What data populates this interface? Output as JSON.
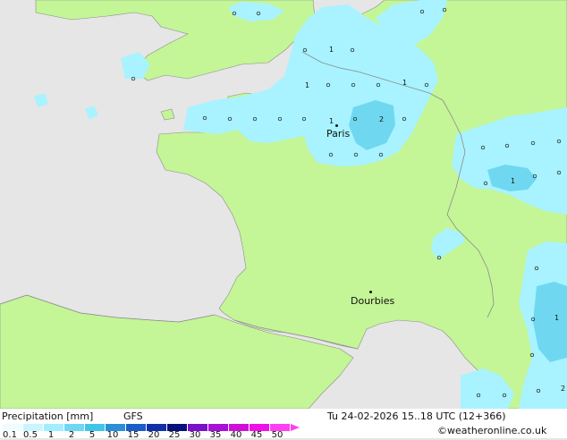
{
  "colors": {
    "sea": "#e6e6e6",
    "land": "#c4f597",
    "precip_light": "#a8f3ff",
    "precip_mid": "#6fd8f0",
    "precip_strong": "#3ec6e8",
    "border": "#8c8c8c"
  },
  "map": {
    "places": [
      {
        "name": "Paris"
      },
      {
        "name": "Dourbies"
      }
    ],
    "value_labels": [
      "1",
      "2",
      "1",
      "1",
      "1",
      "1",
      "1",
      "2"
    ]
  },
  "footer": {
    "title": "Precipitation [mm]",
    "model": "GFS",
    "timestamp": "Tu 24-02-2026 15..18 UTC (12+366)",
    "copyright": "©weatheronline.co.uk"
  },
  "legend": {
    "ticks": [
      "0.1",
      "0.5",
      "1",
      "2",
      "5",
      "10",
      "15",
      "20",
      "25",
      "30",
      "35",
      "40",
      "45",
      "50"
    ],
    "colors": [
      "#f0fcff",
      "#c8f5ff",
      "#a0eeff",
      "#6fd8f0",
      "#3ec6e8",
      "#2a8ed8",
      "#1c5cc8",
      "#1030a8",
      "#08107a",
      "#7a10c8",
      "#a810d8",
      "#d010d8",
      "#f010e8",
      "#ff40f0"
    ]
  }
}
